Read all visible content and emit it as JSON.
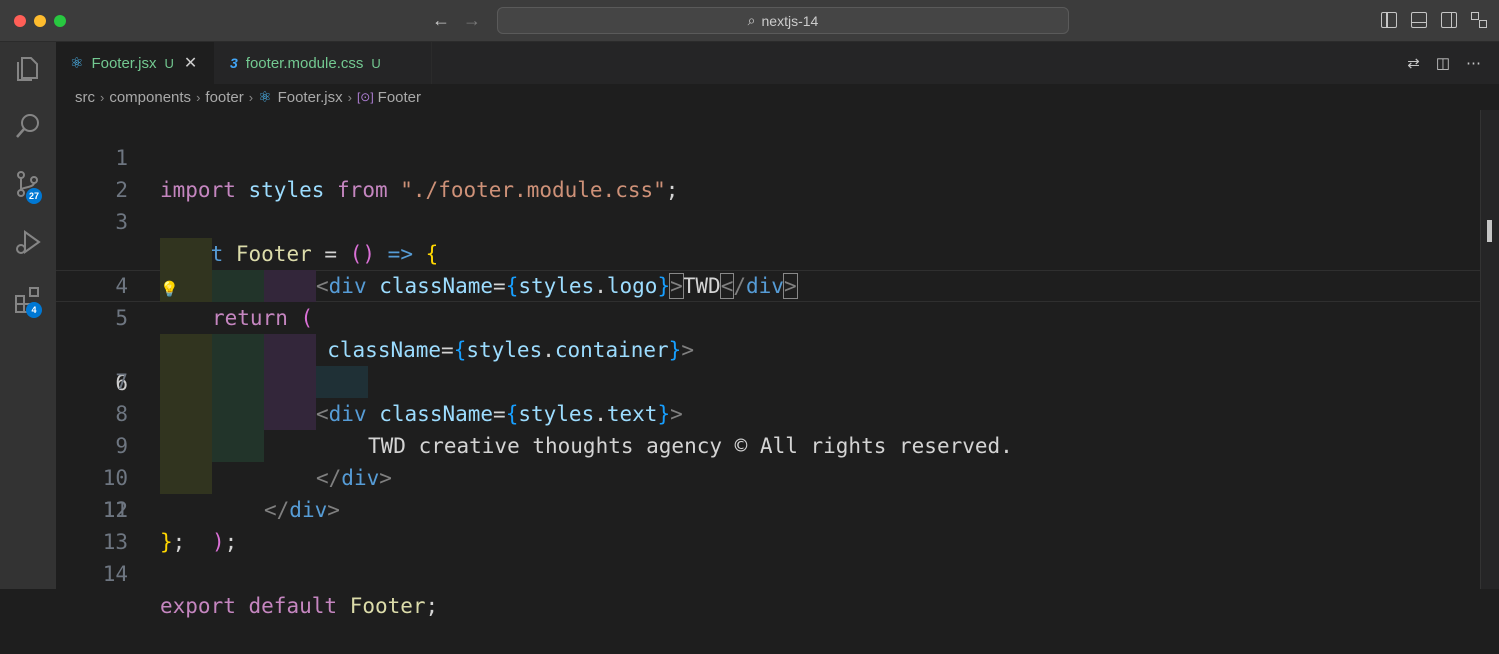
{
  "window": {
    "search": "nextjs-14"
  },
  "tabs": [
    {
      "name": "Footer.jsx",
      "status": "U",
      "active": true
    },
    {
      "name": "footer.module.css",
      "status": "U",
      "active": false
    }
  ],
  "breadcrumb": [
    "src",
    "components",
    "footer",
    "Footer.jsx",
    "Footer"
  ],
  "activity_bar": {
    "source_control_badge": "27",
    "extensions_badge": "4"
  },
  "editor": {
    "current_line": 6,
    "lines": [
      {
        "n": "1",
        "text": "import styles from \"./footer.module.css\";"
      },
      {
        "n": "2",
        "text": ""
      },
      {
        "n": "3",
        "text": "const Footer = () => {"
      },
      {
        "n": "4",
        "text": "return ("
      },
      {
        "n": "5",
        "text": "<div className={styles.container}>"
      },
      {
        "n": "6",
        "text": "<div className={styles.logo}>TWD</div>"
      },
      {
        "n": "7",
        "text": "<div className={styles.text}>"
      },
      {
        "n": "8",
        "text": "TWD creative thoughts agency © All rights reserved."
      },
      {
        "n": "9",
        "text": "</div>"
      },
      {
        "n": "10",
        "text": "</div>"
      },
      {
        "n": "11",
        "text": ");"
      },
      {
        "n": "12",
        "text": "};"
      },
      {
        "n": "13",
        "text": ""
      },
      {
        "n": "14",
        "text": "export default Footer;"
      }
    ],
    "tokens": {
      "import": "import",
      "styles": "styles",
      "from": "from",
      "path": "\"./footer.module.css\"",
      "semi": ";",
      "const": "const",
      "Footer": "Footer",
      "eq": "=",
      "lp": "(",
      "rp": ")",
      "arrow": "=>",
      "lb": "{",
      "rb": "}",
      "return": "return",
      "lt": "<",
      "ltslash": "</",
      "gt": ">",
      "div": "div",
      "className": "className",
      "container": "container",
      "logo": "logo",
      "text": "text",
      "dot": ".",
      "twd": "TWD",
      "footer_text": "TWD creative thoughts agency © All rights reserved.",
      "export": "export",
      "default": "default"
    }
  }
}
